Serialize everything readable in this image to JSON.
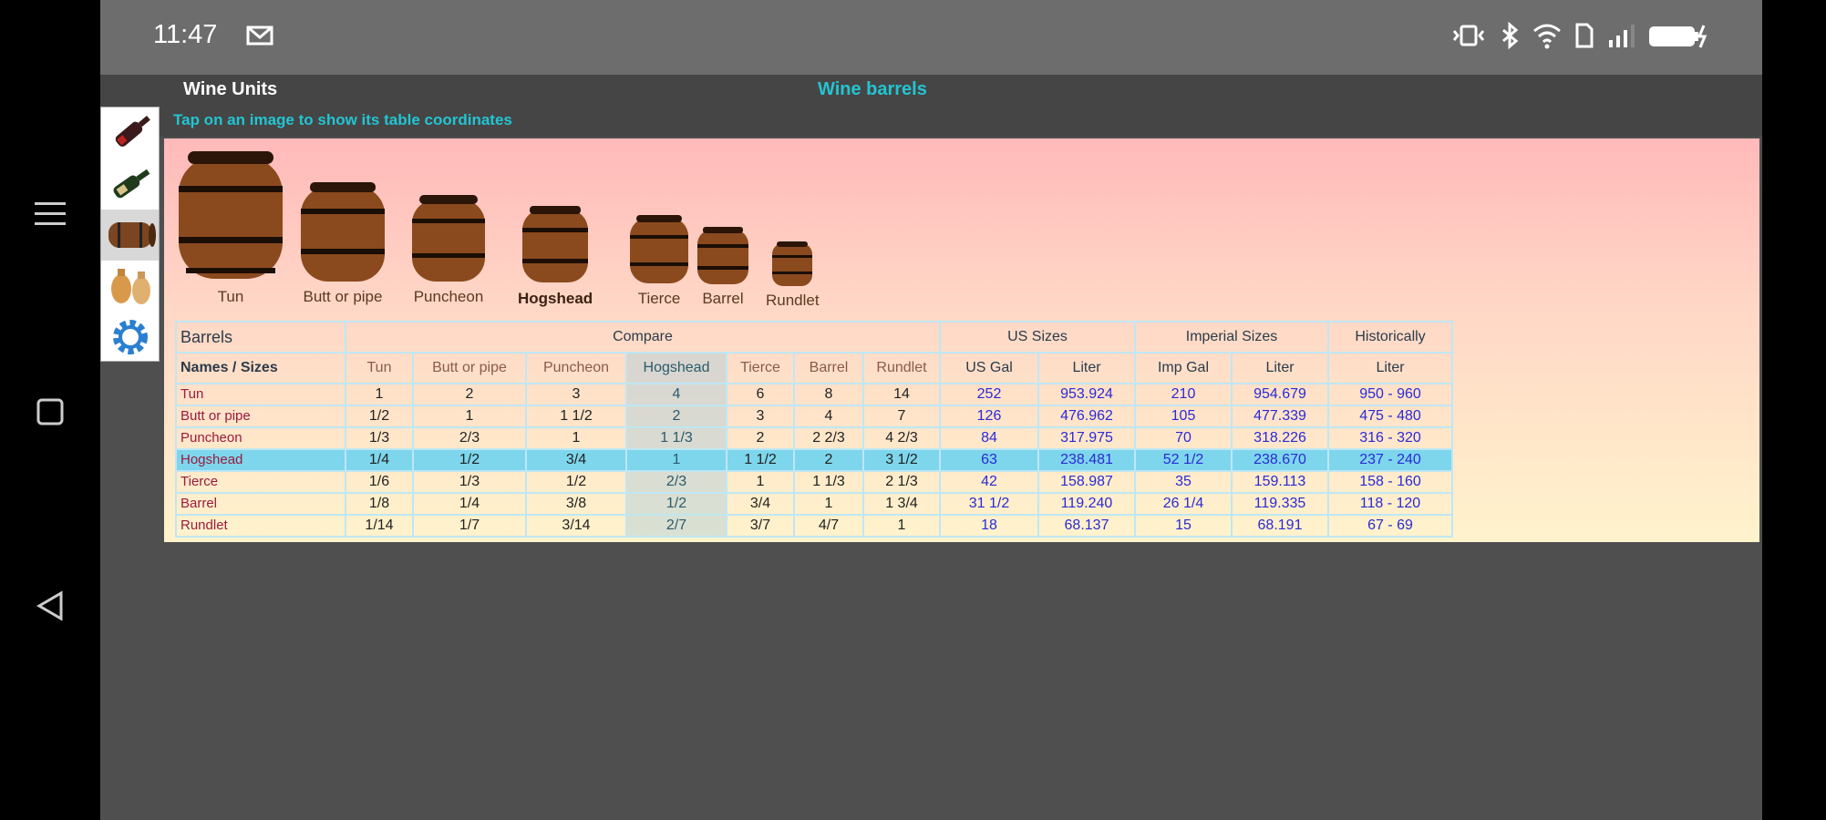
{
  "status": {
    "time": "11:47"
  },
  "app": {
    "title": "Wine Units",
    "subtitle": "Wine barrels",
    "hint": "Tap on an image to show its table coordinates"
  },
  "sidebar": {
    "items": [
      {
        "icon": "wine-bottle-dark-icon"
      },
      {
        "icon": "wine-bottle-green-icon"
      },
      {
        "icon": "barrel-icon",
        "active": true
      },
      {
        "icon": "amphora-icon"
      },
      {
        "icon": "gear-icon"
      }
    ]
  },
  "barrels": [
    {
      "label": "Tun"
    },
    {
      "label": "Butt or pipe"
    },
    {
      "label": "Puncheon"
    },
    {
      "label": "Hogshead",
      "selected": true
    },
    {
      "label": "Tierce"
    },
    {
      "label": "Barrel"
    },
    {
      "label": "Rundlet"
    }
  ],
  "table": {
    "group_headers": {
      "barrels": "Barrels",
      "compare": "Compare",
      "us": "US Sizes",
      "imperial": "Imperial Sizes",
      "historically": "Historically"
    },
    "sub_headers": [
      "Names / Sizes",
      "Tun",
      "Butt or pipe",
      "Puncheon",
      "Hogshead",
      "Tierce",
      "Barrel",
      "Rundlet",
      "US Gal",
      "Liter",
      "Imp Gal",
      "Liter",
      "Liter"
    ],
    "rows": [
      {
        "name": "Tun",
        "values": [
          "1",
          "2",
          "3",
          "4",
          "6",
          "8",
          "14",
          "252",
          "953.924",
          "210",
          "954.679",
          "950 - 960"
        ]
      },
      {
        "name": "Butt or pipe",
        "values": [
          "1/2",
          "1",
          "1 1/2",
          "2",
          "3",
          "4",
          "7",
          "126",
          "476.962",
          "105",
          "477.339",
          "475 - 480"
        ]
      },
      {
        "name": "Puncheon",
        "values": [
          "1/3",
          "2/3",
          "1",
          "1 1/3",
          "2",
          "2 2/3",
          "4 2/3",
          "84",
          "317.975",
          "70",
          "318.226",
          "316 - 320"
        ]
      },
      {
        "name": "Hogshead",
        "values": [
          "1/4",
          "1/2",
          "3/4",
          "1",
          "1 1/2",
          "2",
          "3 1/2",
          "63",
          "238.481",
          "52 1/2",
          "238.670",
          "237 - 240"
        ],
        "highlight": true
      },
      {
        "name": "Tierce",
        "values": [
          "1/6",
          "1/3",
          "1/2",
          "2/3",
          "1",
          "1 1/3",
          "2 1/3",
          "42",
          "158.987",
          "35",
          "159.113",
          "158 - 160"
        ]
      },
      {
        "name": "Barrel",
        "values": [
          "1/8",
          "1/4",
          "3/8",
          "1/2",
          "3/4",
          "1",
          "1 3/4",
          "31 1/2",
          "119.240",
          "26 1/4",
          "119.335",
          "118 - 120"
        ]
      },
      {
        "name": "Rundlet",
        "values": [
          "1/14",
          "1/7",
          "3/14",
          "2/7",
          "3/7",
          "4/7",
          "1",
          "18",
          "68.137",
          "15",
          "68.191",
          "67 - 69"
        ]
      }
    ]
  }
}
